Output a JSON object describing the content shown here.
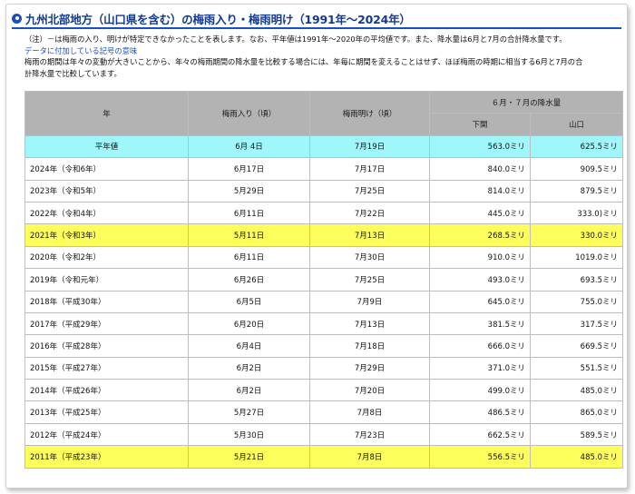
{
  "title": "九州北部地方（山口県を含む）の梅雨入り・梅雨明け（1991年〜2024年）",
  "notes": {
    "line1": "（注）－は梅雨の入り、明けが特定できなかったことを表します。なお、平年値は1991年〜2020年の平均値です。また、降水量は6月と7月の合計降水量です。",
    "link": "データに付加している記号の意味",
    "line3": "梅雨の期間は年々の変動が大きいことから、年々の梅雨期間の降水量を比較する場合には、年毎に期間を変えることはせず、ほぼ梅雨の時期に相当する6月と7月の合",
    "line4": "計降水量で比較しています。"
  },
  "table": {
    "headers": {
      "year": "年",
      "start": "梅雨入り（頃）",
      "end": "梅雨明け（頃）",
      "rain_group": "６月・７月の降水量",
      "city1": "下関",
      "city2": "山口"
    },
    "normal_row": [
      "平年値",
      "6月 4日",
      "7月19日",
      "563.0ミリ",
      "625.5ミリ"
    ],
    "rows": [
      [
        "2024年（令和6年）",
        "6月17日",
        "7月17日",
        "840.0ミリ",
        "909.5ミリ"
      ],
      [
        "2023年（令和5年）",
        "5月29日",
        "7月25日",
        "814.0ミリ",
        "879.5ミリ"
      ],
      [
        "2022年（令和4年）",
        "6月11日",
        "7月22日",
        "445.0ミリ",
        "333.0)ミリ"
      ],
      [
        "2021年（令和3年）",
        "5月11日",
        "7月13日",
        "268.5ミリ",
        "330.0ミリ"
      ],
      [
        "2020年（令和2年）",
        "6月11日",
        "7月30日",
        "910.0ミリ",
        "1019.0ミリ"
      ],
      [
        "2019年（令和元年）",
        "6月26日",
        "7月25日",
        "493.0ミリ",
        "693.5ミリ"
      ],
      [
        "2018年（平成30年）",
        "6月5日",
        "7月9日",
        "645.0ミリ",
        "755.0ミリ"
      ],
      [
        "2017年（平成29年）",
        "6月20日",
        "7月13日",
        "381.5ミリ",
        "317.5ミリ"
      ],
      [
        "2016年（平成28年）",
        "6月4日",
        "7月18日",
        "666.0ミリ",
        "669.5ミリ"
      ],
      [
        "2015年（平成27年）",
        "6月2日",
        "7月29日",
        "371.0ミリ",
        "551.5ミリ"
      ],
      [
        "2014年（平成26年）",
        "6月2日",
        "7月20日",
        "499.0ミリ",
        "485.0ミリ"
      ],
      [
        "2013年（平成25年）",
        "5月27日",
        "7月8日",
        "486.5ミリ",
        "865.0ミリ"
      ],
      [
        "2012年（平成24年）",
        "5月30日",
        "7月23日",
        "662.5ミリ",
        "589.5ミリ"
      ],
      [
        "2011年（平成23年）",
        "5月21日",
        "7月8日",
        "556.5ミリ",
        "485.0ミリ"
      ]
    ],
    "highlighted_years": [
      "2021年（令和3年）",
      "2011年（平成23年）"
    ],
    "colors": {
      "normal_row": "#9ff7fb",
      "highlight_row": "#fdfd5c",
      "header": "#b3b3b3",
      "title": "#123a94",
      "accent": "#1a4fc0"
    }
  }
}
